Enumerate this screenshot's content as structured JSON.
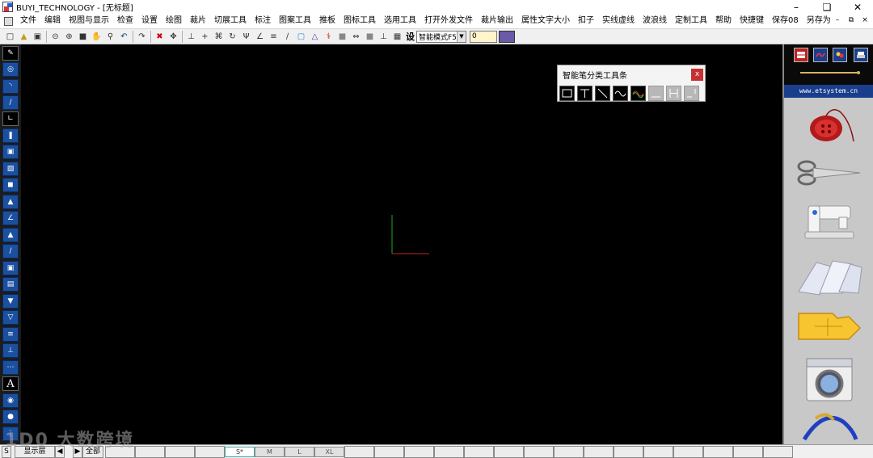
{
  "window": {
    "title": "BUYI_TECHNOLOGY - [无标题]",
    "controls": [
      "minimize-icon",
      "maximize-icon",
      "close-icon"
    ]
  },
  "menu": {
    "items": [
      "文件",
      "编辑",
      "视图与显示",
      "检查",
      "设置",
      "绘图",
      "裁片",
      "切展工具",
      "标注",
      "图案工具",
      "推板",
      "图标工具",
      "选用工具",
      "打开外发文件",
      "裁片输出",
      "属性文字大小",
      "扣子",
      "实线虚线",
      "波浪线",
      "定制工具",
      "帮助",
      "快捷键",
      "保存08",
      "另存为"
    ]
  },
  "toolbar": {
    "set_label": "设",
    "mode_value": "智能模式F5",
    "number_value": "0"
  },
  "float_toolbar": {
    "title": "智能笔分类工具条",
    "close_label": "x",
    "tools": [
      "rectangle-tool-icon",
      "t-tool-icon",
      "diagonal-line-icon",
      "wave-line-icon",
      "color-wave-icon",
      "line-tool-icon",
      "h-tool-icon",
      "corner-tool-icon"
    ]
  },
  "right_panel": {
    "url": "www.etsystem.cn",
    "icons": [
      "button-thread-icon",
      "scissors-icon",
      "sewing-machine-icon",
      "fabric-sheets-icon",
      "pattern-piece-icon",
      "washing-machine-icon",
      "hanger-icon"
    ]
  },
  "status": {
    "left_label": "S",
    "display_label": "显示层",
    "all_label": "全部",
    "sizes": [
      "S*",
      "M",
      "L",
      "XL"
    ]
  },
  "watermark": "1D0 大数跨境",
  "colors": {
    "canvas": "#000000",
    "axis_x": "#cc2222",
    "axis_y": "#22aa22",
    "tool_blue": "#1b4fa0",
    "url_bar": "#1a3e8c"
  }
}
